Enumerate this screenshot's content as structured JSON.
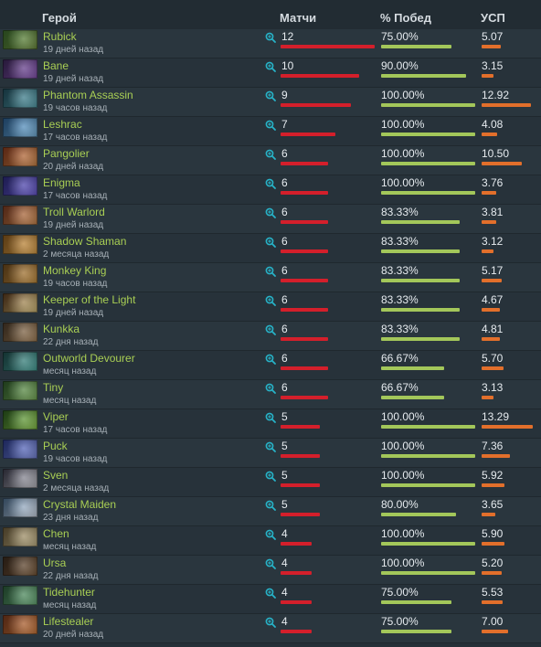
{
  "header": {
    "hero": "Герой",
    "matches": "Матчи",
    "winrate": "% Побед",
    "kda": "УСП"
  },
  "colors": {
    "name": "#a9cf54",
    "matches_bar": "#d41f2b",
    "win_bar": "#a3c75a",
    "kda_bar": "#e26f2b"
  },
  "max_matches": 12,
  "max_kda": 13.29,
  "rows": [
    {
      "hero": "Rubick",
      "time": "19 дней назад",
      "matches": "12",
      "win": "75.00%",
      "kda": "5.07",
      "winpct": 75.0,
      "kdanum": 5.07,
      "mnum": 12,
      "portrait": [
        "#3c6b2d",
        "#6e8f3e"
      ]
    },
    {
      "hero": "Bane",
      "time": "19 дней назад",
      "matches": "10",
      "win": "90.00%",
      "kda": "3.15",
      "winpct": 90.0,
      "kdanum": 3.15,
      "mnum": 10,
      "portrait": [
        "#3b2657",
        "#8a56b8"
      ]
    },
    {
      "hero": "Phantom Assassin",
      "time": "19 часов назад",
      "matches": "9",
      "win": "100.00%",
      "kda": "12.92",
      "winpct": 100.0,
      "kdanum": 12.92,
      "mnum": 9,
      "portrait": [
        "#1f4b5a",
        "#58a6b3"
      ]
    },
    {
      "hero": "Leshrac",
      "time": "17 часов назад",
      "matches": "7",
      "win": "100.00%",
      "kda": "4.08",
      "winpct": 100.0,
      "kdanum": 4.08,
      "mnum": 7,
      "portrait": [
        "#2a5d8f",
        "#77b6e0"
      ]
    },
    {
      "hero": "Pangolier",
      "time": "20 дней назад",
      "matches": "6",
      "win": "100.00%",
      "kda": "10.50",
      "winpct": 100.0,
      "kdanum": 10.5,
      "mnum": 6,
      "portrait": [
        "#8a3b1e",
        "#d1894a"
      ]
    },
    {
      "hero": "Enigma",
      "time": "17 часов назад",
      "matches": "6",
      "win": "100.00%",
      "kda": "3.76",
      "winpct": 100.0,
      "kdanum": 3.76,
      "mnum": 6,
      "portrait": [
        "#2b2a7a",
        "#6b5cd6"
      ]
    },
    {
      "hero": "Troll Warlord",
      "time": "19 дней назад",
      "matches": "6",
      "win": "83.33%",
      "kda": "3.81",
      "winpct": 83.33,
      "kdanum": 3.81,
      "mnum": 6,
      "portrait": [
        "#7a3a22",
        "#d08a4e"
      ]
    },
    {
      "hero": "Shadow Shaman",
      "time": "2 месяца назад",
      "matches": "6",
      "win": "83.33%",
      "kda": "3.12",
      "winpct": 83.33,
      "kdanum": 3.12,
      "mnum": 6,
      "portrait": [
        "#8a5a1e",
        "#e0a44a"
      ]
    },
    {
      "hero": "Monkey King",
      "time": "19 часов назад",
      "matches": "6",
      "win": "83.33%",
      "kda": "5.17",
      "winpct": 83.33,
      "kdanum": 5.17,
      "mnum": 6,
      "portrait": [
        "#6e4a1e",
        "#c8913f"
      ]
    },
    {
      "hero": "Keeper of the Light",
      "time": "19 дней назад",
      "matches": "6",
      "win": "83.33%",
      "kda": "4.67",
      "winpct": 83.33,
      "kdanum": 4.67,
      "mnum": 6,
      "portrait": [
        "#5a3a1e",
        "#d8c07a"
      ]
    },
    {
      "hero": "Kunkka",
      "time": "22 дня назад",
      "matches": "6",
      "win": "83.33%",
      "kda": "4.81",
      "winpct": 83.33,
      "kdanum": 4.81,
      "mnum": 6,
      "portrait": [
        "#4a3a2a",
        "#a8845a"
      ]
    },
    {
      "hero": "Outworld Devourer",
      "time": "месяц назад",
      "matches": "6",
      "win": "66.67%",
      "kda": "5.70",
      "winpct": 66.67,
      "kdanum": 5.7,
      "mnum": 6,
      "portrait": [
        "#1e4a4a",
        "#4aa8a0"
      ]
    },
    {
      "hero": "Tiny",
      "time": "месяц назад",
      "matches": "6",
      "win": "66.67%",
      "kda": "3.13",
      "winpct": 66.67,
      "kdanum": 3.13,
      "mnum": 6,
      "portrait": [
        "#2e5a2a",
        "#7ab05a"
      ]
    },
    {
      "hero": "Viper",
      "time": "17 часов назад",
      "matches": "5",
      "win": "100.00%",
      "kda": "13.29",
      "winpct": 100.0,
      "kdanum": 13.29,
      "mnum": 5,
      "portrait": [
        "#2a5a1e",
        "#8ac84a"
      ]
    },
    {
      "hero": "Puck",
      "time": "19 часов назад",
      "matches": "5",
      "win": "100.00%",
      "kda": "7.36",
      "winpct": 100.0,
      "kdanum": 7.36,
      "mnum": 5,
      "portrait": [
        "#2a3a8a",
        "#7a8ae0"
      ]
    },
    {
      "hero": "Sven",
      "time": "2 месяца назад",
      "matches": "5",
      "win": "100.00%",
      "kda": "5.92",
      "winpct": 100.0,
      "kdanum": 5.92,
      "mnum": 5,
      "portrait": [
        "#3a3a4a",
        "#c0c0c8"
      ]
    },
    {
      "hero": "Crystal Maiden",
      "time": "23 дня назад",
      "matches": "5",
      "win": "80.00%",
      "kda": "3.65",
      "winpct": 80.0,
      "kdanum": 3.65,
      "mnum": 5,
      "portrait": [
        "#4a6a8a",
        "#d0dcea"
      ]
    },
    {
      "hero": "Chen",
      "time": "месяц назад",
      "matches": "4",
      "win": "100.00%",
      "kda": "5.90",
      "winpct": 100.0,
      "kdanum": 5.9,
      "mnum": 4,
      "portrait": [
        "#6a5a3a",
        "#c8b88a"
      ]
    },
    {
      "hero": "Ursa",
      "time": "22 дня назад",
      "matches": "4",
      "win": "100.00%",
      "kda": "5.20",
      "winpct": 100.0,
      "kdanum": 5.2,
      "mnum": 4,
      "portrait": [
        "#3a2a1e",
        "#7a5a3a"
      ]
    },
    {
      "hero": "Tidehunter",
      "time": "месяц назад",
      "matches": "4",
      "win": "75.00%",
      "kda": "5.53",
      "winpct": 75.0,
      "kdanum": 5.53,
      "mnum": 4,
      "portrait": [
        "#2a5a3a",
        "#6ab07a"
      ]
    },
    {
      "hero": "Lifestealer",
      "time": "20 дней назад",
      "matches": "4",
      "win": "75.00%",
      "kda": "7.00",
      "winpct": 75.0,
      "kdanum": 7.0,
      "mnum": 4,
      "portrait": [
        "#7a3a1e",
        "#d07a3a"
      ]
    }
  ]
}
